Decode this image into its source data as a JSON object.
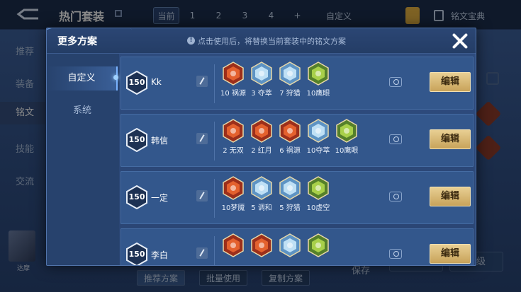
{
  "background": {
    "title": "热门套装",
    "tabs": [
      "当前",
      "1",
      "2",
      "3",
      "4",
      "+"
    ],
    "custom_label": "自定义",
    "dict_label": "铭文宝典",
    "sidebar": [
      "推荐",
      "装备",
      "铭文",
      "技能",
      "交流"
    ],
    "hero_name": "达摩",
    "bottom_buttons": [
      "推荐方案",
      "批量使用",
      "复制方案"
    ],
    "save_label": "保存",
    "advanced_label": "高级"
  },
  "modal": {
    "title": "更多方案",
    "hint": "点击使用后，将替换当前套装中的铭文方案",
    "nav": [
      "自定义",
      "系统"
    ],
    "edit_label": "编辑",
    "plans": [
      {
        "level": "150",
        "name": "Kk",
        "runes": [
          {
            "label": "10 祸源",
            "color": "red"
          },
          {
            "label": "3 夺萃",
            "color": "blue"
          },
          {
            "label": "7 狩猎",
            "color": "blue"
          },
          {
            "label": "10鹰眼",
            "color": "green"
          }
        ]
      },
      {
        "level": "150",
        "name": "韩信",
        "runes": [
          {
            "label": "2 无双",
            "color": "red"
          },
          {
            "label": "2 红月",
            "color": "red"
          },
          {
            "label": "6 祸源",
            "color": "red"
          },
          {
            "label": "10夺萃",
            "color": "blue"
          },
          {
            "label": "10鹰眼",
            "color": "green"
          }
        ]
      },
      {
        "level": "150",
        "name": "一定",
        "runes": [
          {
            "label": "10梦魇",
            "color": "red"
          },
          {
            "label": "5 调和",
            "color": "blue"
          },
          {
            "label": "5 狩猎",
            "color": "blue"
          },
          {
            "label": "10虚空",
            "color": "green"
          }
        ]
      },
      {
        "level": "150",
        "name": "李白",
        "runes": [
          {
            "label": "",
            "color": "red"
          },
          {
            "label": "",
            "color": "red"
          },
          {
            "label": "",
            "color": "blue"
          },
          {
            "label": "",
            "color": "green"
          }
        ]
      }
    ]
  },
  "colors": {
    "red": "#c3482a",
    "blue": "#7fb0d8",
    "green": "#7aa83a",
    "gold": "#d7b46f"
  }
}
